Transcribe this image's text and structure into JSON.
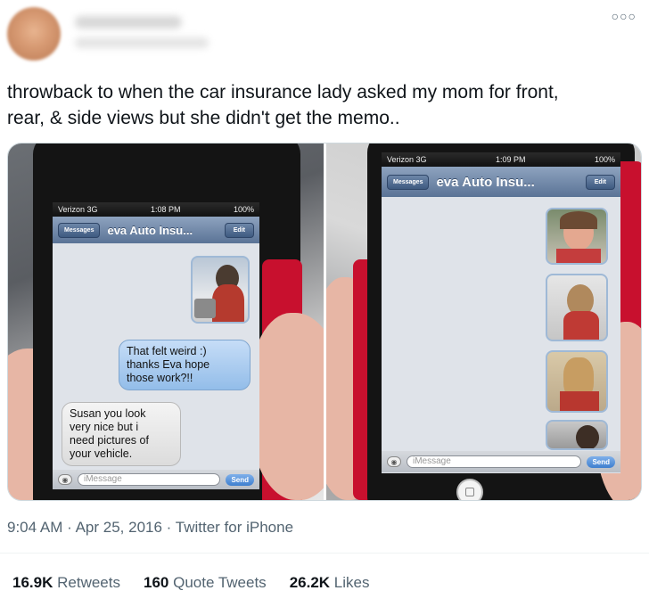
{
  "tweet": {
    "menu_icon": "more-dots-icon",
    "text": "throwback to when the car insurance lady asked my mom for front,\nrear, & side views but she didn't get the memo..",
    "timestamp": "9:04 AM",
    "separator": "·",
    "date": "Apr 25, 2016",
    "source": "Twitter for iPhone"
  },
  "stats": [
    {
      "count": "16.9K",
      "label": "Retweets"
    },
    {
      "count": "160",
      "label": "Quote Tweets"
    },
    {
      "count": "26.2K",
      "label": "Likes"
    }
  ],
  "left_phone": {
    "carrier": "Verizon 3G",
    "time": "1:08 PM",
    "battery": "100%",
    "back": "Messages",
    "title": "eva Auto Insu...",
    "edit": "Edit",
    "sent": "That felt weird :)\nthanks Eva hope\nthose work?!!",
    "received": "Susan you look\nvery nice but i\nneed pictures of\nyour vehicle.",
    "input_placeholder": "iMessage",
    "send": "Send"
  },
  "right_phone": {
    "carrier": "Verizon 3G",
    "time": "1:09 PM",
    "battery": "100%",
    "back": "Messages",
    "title": "eva Auto Insu...",
    "edit": "Edit",
    "input_placeholder": "iMessage",
    "send": "Send"
  }
}
